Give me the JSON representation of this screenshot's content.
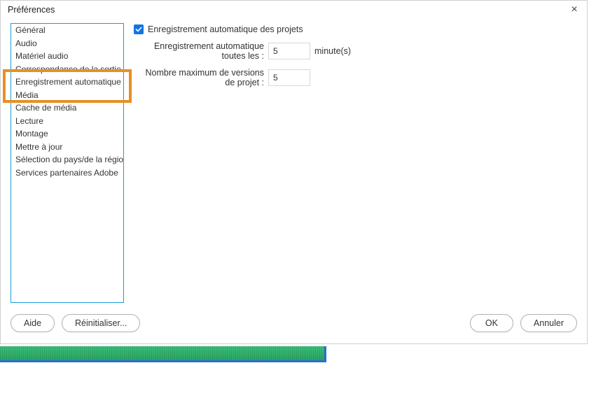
{
  "dialog": {
    "title": "Préférences"
  },
  "sidebar": {
    "items": [
      "Général",
      "Audio",
      "Matériel audio",
      "Correspondance de la sortie audio",
      "Enregistrement automatique",
      "Média",
      "Cache de média",
      "Lecture",
      "Montage",
      "Mettre à jour",
      "Sélection du pays/de la région",
      "Services partenaires Adobe"
    ]
  },
  "form": {
    "autosave_checkbox": "Enregistrement automatique des projets",
    "interval_label": "Enregistrement automatique toutes les :",
    "interval_value": "5",
    "interval_unit": "minute(s)",
    "maxversions_label": "Nombre maximum de versions de projet :",
    "maxversions_value": "5"
  },
  "buttons": {
    "help": "Aide",
    "reset": "Réinitialiser...",
    "ok": "OK",
    "cancel": "Annuler"
  }
}
